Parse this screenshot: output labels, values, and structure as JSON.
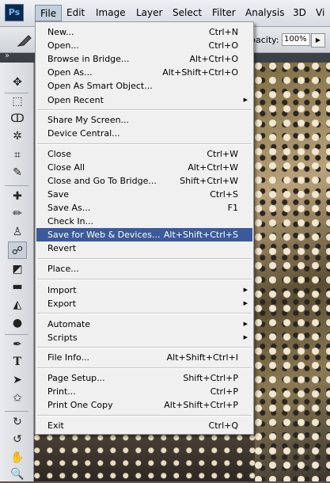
{
  "menubar": {
    "logo": "Ps",
    "items": [
      "File",
      "Edit",
      "Image",
      "Layer",
      "Select",
      "Filter",
      "Analysis",
      "3D",
      "Vi"
    ]
  },
  "options_bar": {
    "opacity_label": "pacity:",
    "opacity_value": "100%",
    "dropdown_arrow": "▶"
  },
  "file_menu": {
    "items": [
      {
        "label": "New...",
        "shortcut": "Ctrl+N"
      },
      {
        "label": "Open...",
        "shortcut": "Ctrl+O"
      },
      {
        "label": "Browse in Bridge...",
        "shortcut": "Alt+Ctrl+O"
      },
      {
        "label": "Open As...",
        "shortcut": "Alt+Shift+Ctrl+O"
      },
      {
        "label": "Open As Smart Object...",
        "shortcut": ""
      },
      {
        "label": "Open Recent",
        "shortcut": "",
        "submenu": true
      },
      {
        "label": "Share My Screen...",
        "shortcut": ""
      },
      {
        "label": "Device Central...",
        "shortcut": ""
      },
      {
        "label": "Close",
        "shortcut": "Ctrl+W"
      },
      {
        "label": "Close All",
        "shortcut": "Alt+Ctrl+W"
      },
      {
        "label": "Close and Go To Bridge...",
        "shortcut": "Shift+Ctrl+W"
      },
      {
        "label": "Save",
        "shortcut": "Ctrl+S"
      },
      {
        "label": "Save As...",
        "shortcut": "F1"
      },
      {
        "label": "Check In...",
        "shortcut": ""
      },
      {
        "label": "Save for Web & Devices...",
        "shortcut": "Alt+Shift+Ctrl+S",
        "highlighted": true
      },
      {
        "label": "Revert",
        "shortcut": ""
      },
      {
        "label": "Place...",
        "shortcut": ""
      },
      {
        "label": "Import",
        "shortcut": "",
        "submenu": true
      },
      {
        "label": "Export",
        "shortcut": "",
        "submenu": true
      },
      {
        "label": "Automate",
        "shortcut": "",
        "submenu": true
      },
      {
        "label": "Scripts",
        "shortcut": "",
        "submenu": true
      },
      {
        "label": "File Info...",
        "shortcut": "Alt+Shift+Ctrl+I"
      },
      {
        "label": "Page Setup...",
        "shortcut": "Shift+Ctrl+P"
      },
      {
        "label": "Print...",
        "shortcut": "Ctrl+P"
      },
      {
        "label": "Print One Copy",
        "shortcut": "Alt+Shift+Ctrl+P"
      },
      {
        "label": "Exit",
        "shortcut": "Ctrl+Q"
      }
    ],
    "submenu_arrow": "▶"
  },
  "tools": {
    "head_arrows": "»",
    "icons": [
      "move-icon",
      "marquee-icon",
      "lasso-icon",
      "magic-wand-icon",
      "crop-icon",
      "eyedropper-icon",
      "healing-brush-icon",
      "brush-icon",
      "clone-stamp-icon",
      "history-brush-icon",
      "eraser-icon",
      "gradient-icon",
      "blur-icon",
      "dodge-icon",
      "pen-icon",
      "type-icon",
      "path-selection-icon",
      "shape-icon",
      "3d-rotate-icon",
      "3d-orbit-icon",
      "hand-icon",
      "zoom-icon"
    ],
    "glyphs": [
      "✥",
      "⬚",
      "ↀ",
      "✲",
      "⌗",
      "✎",
      "✚",
      "✏",
      "♙",
      "☍",
      "◩",
      "▬",
      "◭",
      "●",
      "✒",
      "T",
      "➤",
      "✩",
      "↻",
      "↺",
      "✋",
      "🔍"
    ]
  },
  "colors": {
    "highlight": "#3b5a9a",
    "menu_bg": "#f0f0f0"
  }
}
